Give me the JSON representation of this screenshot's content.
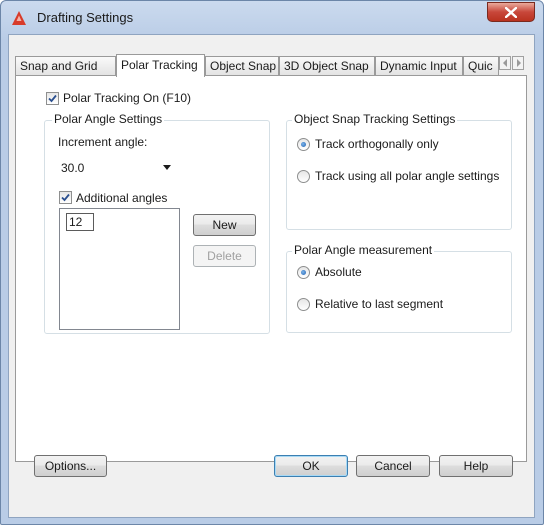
{
  "window": {
    "title": "Drafting Settings",
    "accent_color": "#d83b2a",
    "icons": {
      "app": "autocad-a-icon",
      "close": "close-icon"
    }
  },
  "tabs": [
    {
      "label": "Snap and Grid"
    },
    {
      "label": "Polar Tracking",
      "active": true
    },
    {
      "label": "Object Snap"
    },
    {
      "label": "3D Object Snap"
    },
    {
      "label": "Dynamic Input"
    },
    {
      "label": "Quic"
    }
  ],
  "polar_tracking_on": {
    "label": "Polar Tracking On (F10)",
    "checked": true
  },
  "polar_angle_settings": {
    "title": "Polar Angle Settings",
    "increment_label": "Increment angle:",
    "increment_value": "30.0",
    "additional_label": "Additional angles",
    "additional_checked": true,
    "angles_list_value": "12",
    "new_button": "New",
    "delete_button": "Delete"
  },
  "object_snap_tracking": {
    "title": "Object Snap Tracking Settings",
    "options": [
      {
        "label": "Track orthogonally only",
        "selected": true
      },
      {
        "label": "Track using all polar angle settings",
        "selected": false
      }
    ]
  },
  "polar_angle_measurement": {
    "title": "Polar Angle measurement",
    "options": [
      {
        "label": "Absolute",
        "selected": true
      },
      {
        "label": "Relative to last segment",
        "selected": false
      }
    ]
  },
  "footer": {
    "options_button": "Options...",
    "ok_button": "OK",
    "cancel_button": "Cancel",
    "help_button": "Help"
  }
}
